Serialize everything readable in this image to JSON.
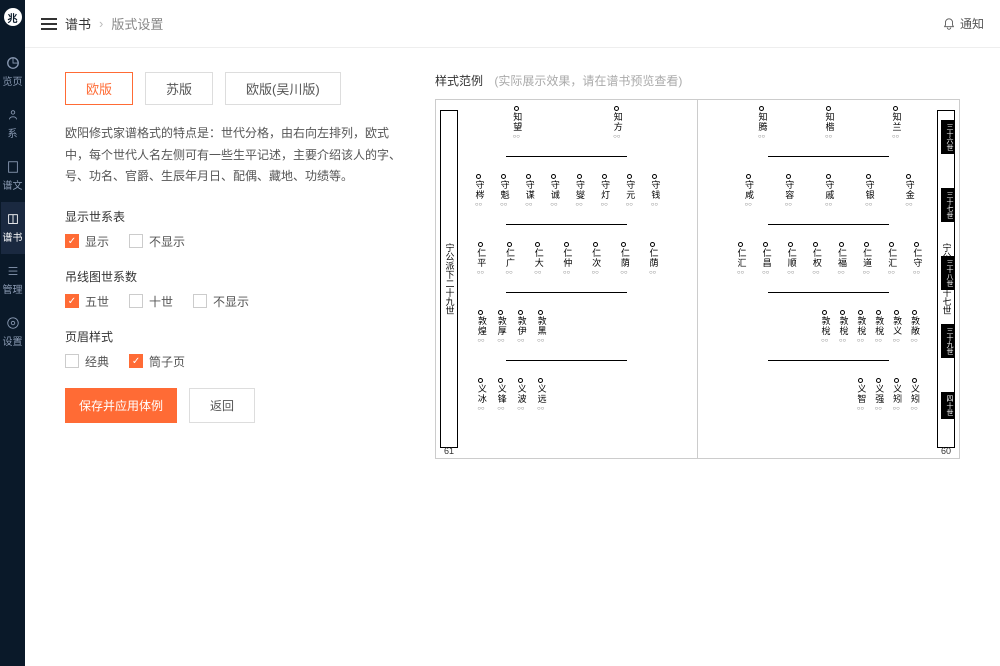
{
  "sidebar": {
    "items": [
      {
        "label": "览页"
      },
      {
        "label": "系"
      },
      {
        "label": "谱文"
      },
      {
        "label": "谱书"
      },
      {
        "label": "管理"
      },
      {
        "label": "设置"
      }
    ]
  },
  "topbar": {
    "menu": "谱书",
    "current": "版式设置",
    "notify": "通知"
  },
  "tabs": [
    {
      "label": "欧版",
      "active": true
    },
    {
      "label": "苏版",
      "active": false
    },
    {
      "label": "欧版(吴川版)",
      "active": false
    }
  ],
  "description": "欧阳修式家谱格式的特点是：世代分格，由右向左排列，欧式中，每个世代人名左侧可有一些生平记述，主要介绍该人的字、号、功名、官爵、生辰年月日、配偶、藏地、功绩等。",
  "options": {
    "showGen": {
      "label": "显示世系表",
      "items": [
        {
          "label": "显示",
          "checked": true
        },
        {
          "label": "不显示",
          "checked": false
        }
      ]
    },
    "lineCount": {
      "label": "吊线图世系数",
      "items": [
        {
          "label": "五世",
          "checked": true
        },
        {
          "label": "十世",
          "checked": false
        },
        {
          "label": "不显示",
          "checked": false
        }
      ]
    },
    "pageStyle": {
      "label": "页眉样式",
      "items": [
        {
          "label": "经典",
          "checked": false
        },
        {
          "label": "筒子页",
          "checked": true
        }
      ]
    }
  },
  "buttons": {
    "save": "保存并应用体例",
    "back": "返回"
  },
  "preview": {
    "title": "样式范例",
    "hint": "(实际展示效果，请在谱书预览查看)",
    "leftPage": {
      "num": "61",
      "margin": "宁公派下二十九世",
      "gens": [
        {
          "people": [
            {
              "n": "知望"
            },
            {
              "n": "知方"
            }
          ]
        },
        {
          "people": [
            {
              "n": "守梣"
            },
            {
              "n": "守魁"
            },
            {
              "n": "守谋"
            },
            {
              "n": "守诚"
            },
            {
              "n": "守燮"
            },
            {
              "n": "守灯"
            },
            {
              "n": "守元"
            },
            {
              "n": "守钱"
            }
          ]
        },
        {
          "people": [
            {
              "n": "仁平"
            },
            {
              "n": "仁广"
            },
            {
              "n": "仁大"
            },
            {
              "n": "仁仲"
            },
            {
              "n": "仁次"
            },
            {
              "n": "仁荫"
            },
            {
              "n": "仁荫"
            }
          ]
        },
        {
          "people": [
            {
              "n": "敦煌"
            },
            {
              "n": "敦厚"
            },
            {
              "n": "敦伊"
            },
            {
              "n": "敦黑"
            }
          ]
        },
        {
          "people": [
            {
              "n": "义冰"
            },
            {
              "n": "义锋"
            },
            {
              "n": "义波"
            },
            {
              "n": "义远"
            }
          ]
        }
      ]
    },
    "rightPage": {
      "num": "60",
      "margin": "宁公派下二十七世",
      "genLabels": [
        "三十六世",
        "三十七世",
        "三十八世",
        "三十九世",
        "四十世"
      ],
      "gens": [
        {
          "people": [
            {
              "n": "知腾"
            },
            {
              "n": "知楷"
            },
            {
              "n": "知兰"
            }
          ]
        },
        {
          "people": [
            {
              "n": "守咸"
            },
            {
              "n": "守容"
            },
            {
              "n": "守戚"
            },
            {
              "n": "守银"
            },
            {
              "n": "守金"
            }
          ]
        },
        {
          "people": [
            {
              "n": "仁汇"
            },
            {
              "n": "仁昌"
            },
            {
              "n": "仁顺"
            },
            {
              "n": "仁权"
            },
            {
              "n": "仁福"
            },
            {
              "n": "仁道"
            },
            {
              "n": "仁汇"
            },
            {
              "n": "仁守"
            }
          ]
        },
        {
          "people": [
            {
              "n": "敦梲"
            },
            {
              "n": "敦梲"
            },
            {
              "n": "敦梲"
            },
            {
              "n": "敦梲"
            },
            {
              "n": "敦义"
            },
            {
              "n": "敦敞"
            }
          ]
        },
        {
          "people": [
            {
              "n": "义智"
            },
            {
              "n": "义强"
            },
            {
              "n": "义矧"
            },
            {
              "n": "义矧"
            }
          ]
        }
      ]
    }
  }
}
